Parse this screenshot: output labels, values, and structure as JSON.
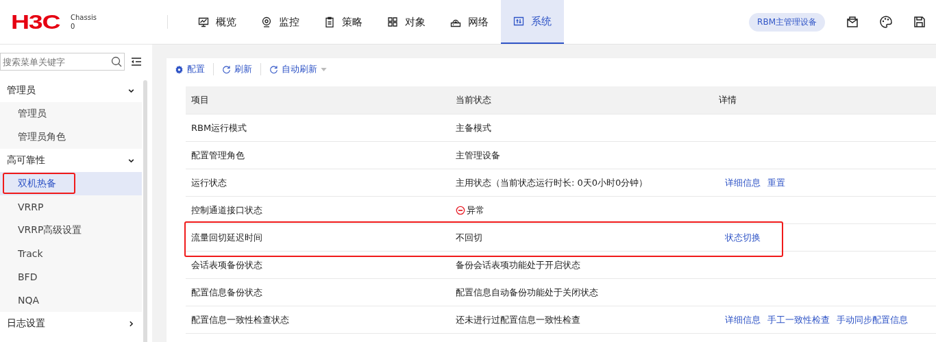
{
  "header": {
    "logo": "H3C",
    "device_label": "Chassis",
    "device_number": "0",
    "nav": [
      {
        "label": "概览",
        "selected": false
      },
      {
        "label": "监控",
        "selected": false
      },
      {
        "label": "策略",
        "selected": false
      },
      {
        "label": "对象",
        "selected": false
      },
      {
        "label": "网络",
        "selected": false
      },
      {
        "label": "系统",
        "selected": true
      }
    ],
    "role_badge": "RBM主管理设备"
  },
  "sidebar": {
    "search": {
      "placeholder": "搜索菜单关键字"
    },
    "groups": [
      {
        "label": "管理员",
        "expanded": true,
        "children": [
          {
            "label": "管理员",
            "selected": false,
            "highlighted": false
          },
          {
            "label": "管理员角色",
            "selected": false,
            "highlighted": false
          }
        ]
      },
      {
        "label": "高可靠性",
        "expanded": true,
        "children": [
          {
            "label": "双机热备",
            "selected": true,
            "highlighted": true
          },
          {
            "label": "VRRP",
            "selected": false,
            "highlighted": false
          },
          {
            "label": "VRRP高级设置",
            "selected": false,
            "highlighted": false
          },
          {
            "label": "Track",
            "selected": false,
            "highlighted": false
          },
          {
            "label": "BFD",
            "selected": false,
            "highlighted": false
          },
          {
            "label": "NQA",
            "selected": false,
            "highlighted": false
          }
        ]
      },
      {
        "label": "日志设置",
        "expanded": false
      }
    ]
  },
  "toolbar": [
    {
      "label": "配置",
      "dropdown": false
    },
    {
      "label": "刷新",
      "dropdown": false
    },
    {
      "label": "自动刷新",
      "dropdown": true
    }
  ],
  "table": {
    "columns": [
      "项目",
      "当前状态",
      "详情"
    ],
    "rows": [
      {
        "kind": "plain",
        "item": "RBM运行模式",
        "status": "主备模式",
        "highlighted": false
      },
      {
        "kind": "plain",
        "item": "配置管理角色",
        "status": "主管理设备",
        "highlighted": false
      },
      {
        "kind": "plain",
        "item": "运行状态",
        "status": "主用状态（当前状态运行时长: 0天0小时0分钟）",
        "details": [
          "详细信息",
          "重置"
        ],
        "highlighted": false
      },
      {
        "kind": "error",
        "item": "控制通道接口状态",
        "status": "异常",
        "highlighted": false
      },
      {
        "kind": "plain",
        "item": "流量回切延迟时间",
        "status": "不回切",
        "details": [
          "状态切换"
        ],
        "highlighted": true
      },
      {
        "kind": "plain",
        "item": "会话表项备份状态",
        "status": "备份会话表项功能处于开启状态",
        "highlighted": false
      },
      {
        "kind": "plain",
        "item": "配置信息备份状态",
        "status": "配置信息自动备份功能处于关闭状态",
        "highlighted": false
      },
      {
        "kind": "plain",
        "item": "配置信息一致性检查状态",
        "status": "还未进行过配置信息一致性检查",
        "details": [
          "详细信息",
          "手工一致性检查",
          "手动同步配置信息"
        ],
        "highlighted": false
      }
    ]
  }
}
